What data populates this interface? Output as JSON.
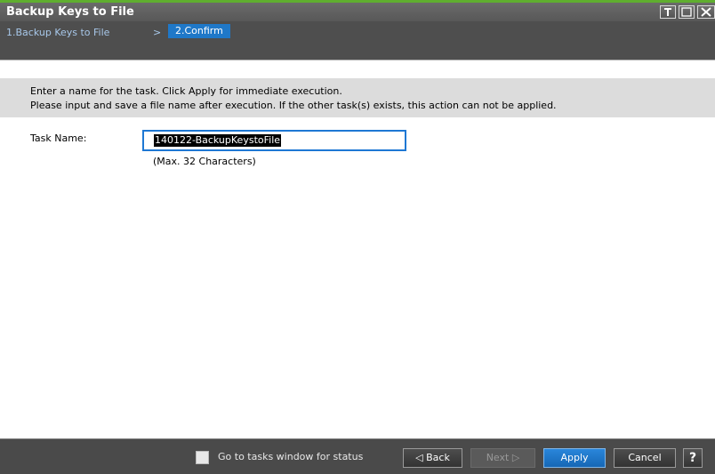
{
  "window": {
    "title": "Backup Keys to File"
  },
  "wizard": {
    "step1": "1.Backup Keys to File",
    "separator": ">",
    "step2": "2.Confirm"
  },
  "info": {
    "line1": "Enter a name for the task. Click Apply for immediate execution.",
    "line2": "Please input and save a file name after execution. If the other task(s) exists, this action can not be applied."
  },
  "task": {
    "label": "Task Name:",
    "value": "140122-BackupKeystoFile",
    "hint": "(Max. 32 Characters)"
  },
  "footer": {
    "checkbox_label": "Go to tasks window for status",
    "checkbox_checked": false,
    "back": "Back",
    "next": "Next",
    "apply": "Apply",
    "cancel": "Cancel",
    "help": "?"
  },
  "colors": {
    "accent": "#1f78c8",
    "title_green": "#5fae2f"
  }
}
